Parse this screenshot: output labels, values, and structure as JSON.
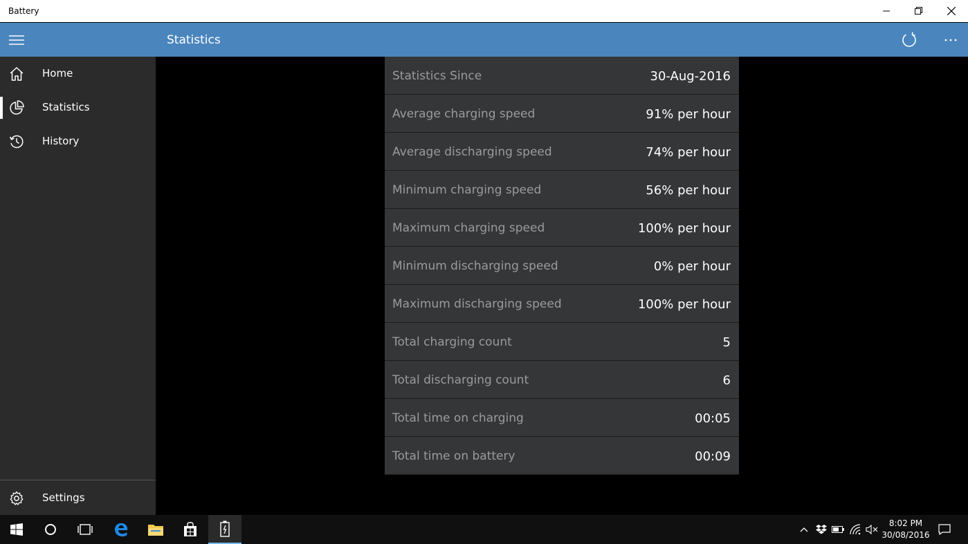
{
  "window": {
    "title": "Battery"
  },
  "appbar": {
    "page_title": "Statistics"
  },
  "nav": {
    "items": [
      {
        "label": "Home",
        "icon": "home-icon"
      },
      {
        "label": "Statistics",
        "icon": "pie-chart-icon",
        "selected": true
      },
      {
        "label": "History",
        "icon": "history-icon"
      }
    ],
    "settings": {
      "label": "Settings",
      "icon": "gear-icon"
    }
  },
  "stats": [
    {
      "key": "Statistics Since",
      "value": "30-Aug-2016"
    },
    {
      "key": "Average charging speed",
      "value": "91% per hour"
    },
    {
      "key": "Average discharging speed",
      "value": "74% per hour"
    },
    {
      "key": "Minimum charging speed",
      "value": "56% per hour"
    },
    {
      "key": "Maximum charging speed",
      "value": "100% per hour"
    },
    {
      "key": "Minimum discharging speed",
      "value": "0% per hour"
    },
    {
      "key": "Maximum discharging speed",
      "value": "100% per hour"
    },
    {
      "key": "Total charging count",
      "value": "5"
    },
    {
      "key": "Total discharging count",
      "value": "6"
    },
    {
      "key": "Total time on charging",
      "value": "00:05"
    },
    {
      "key": "Total time on battery",
      "value": "00:09"
    }
  ],
  "taskbar": {
    "time": "8:02 PM",
    "date": "30/08/2016"
  },
  "colors": {
    "accent": "#4a86bd",
    "sidebar": "#2b2b2b",
    "row_bg": "#343638",
    "taskbar_highlight": "#76b9ed"
  }
}
